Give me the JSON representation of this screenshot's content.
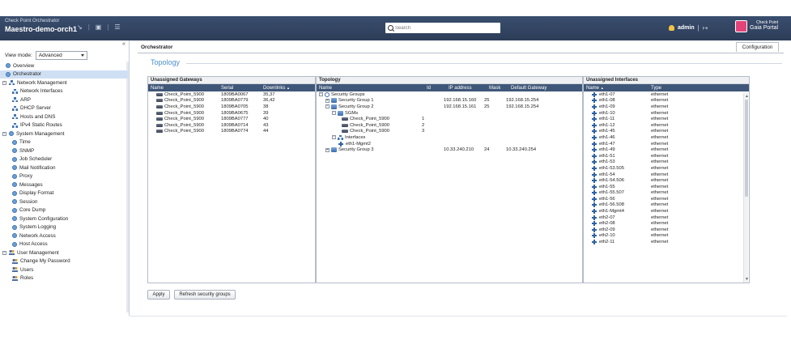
{
  "header": {
    "app_name": "Check Point Orchestrator",
    "host_name": "Maestro-demo-orch1",
    "search_placeholder": "Search",
    "user": "admin",
    "portal_line1": "Check Point",
    "portal_line2": "Gaia Portal"
  },
  "sidebar": {
    "view_mode_label": "View mode:",
    "view_mode_value": "Advanced",
    "items": [
      {
        "label": "Overview"
      },
      {
        "label": "Orchestrator"
      },
      {
        "label": "Network Management"
      },
      {
        "label": "Network Interfaces"
      },
      {
        "label": "ARP"
      },
      {
        "label": "DHCP Server"
      },
      {
        "label": "Hosts and DNS"
      },
      {
        "label": "IPv4 Static Routes"
      },
      {
        "label": "System Management"
      },
      {
        "label": "Time"
      },
      {
        "label": "SNMP"
      },
      {
        "label": "Job Scheduler"
      },
      {
        "label": "Mail Notification"
      },
      {
        "label": "Proxy"
      },
      {
        "label": "Messages"
      },
      {
        "label": "Display Format"
      },
      {
        "label": "Session"
      },
      {
        "label": "Core Dump"
      },
      {
        "label": "System Configuration"
      },
      {
        "label": "System Logging"
      },
      {
        "label": "Network Access"
      },
      {
        "label": "Host Access"
      },
      {
        "label": "User Management"
      },
      {
        "label": "Change My Password"
      },
      {
        "label": "Users"
      },
      {
        "label": "Roles"
      }
    ]
  },
  "main": {
    "breadcrumb": "Orchestrator",
    "config_tab": "Configuration",
    "section_title": "Topology",
    "apply_button": "Apply",
    "refresh_button": "Refresh security groups"
  },
  "unassigned_gateways": {
    "title": "Unassigned Gateways",
    "columns": [
      "Name",
      "Serial",
      "Downlinks"
    ],
    "sort_indicator": "▲",
    "rows": [
      [
        "Check_Point_5900",
        "1809BA0067",
        "35,37"
      ],
      [
        "Check_Point_5900",
        "1809BA0779",
        "36,42"
      ],
      [
        "Check_Point_5900",
        "1809BA0705",
        "38"
      ],
      [
        "Check_Point_5900",
        "1809BA0675",
        "39"
      ],
      [
        "Check_Point_5900",
        "1809BA0777",
        "40"
      ],
      [
        "Check_Point_5900",
        "1809BA0714",
        "43"
      ],
      [
        "Check_Point_5900",
        "1809BA0774",
        "44"
      ]
    ]
  },
  "topology": {
    "title": "Topology",
    "columns": [
      "Name",
      "Id",
      "IP address",
      "Mask",
      "Default Gateway"
    ],
    "rows": [
      {
        "name": "Security Groups",
        "id": "",
        "ip": "",
        "mask": "",
        "gw": ""
      },
      {
        "name": "Security Group 1",
        "id": "",
        "ip": "192.168.15.160",
        "mask": "25",
        "gw": "192.168.15.254"
      },
      {
        "name": "Security Group 2",
        "id": "",
        "ip": "192.168.15.161",
        "mask": "25",
        "gw": "192.168.15.254"
      },
      {
        "name": "SGMs",
        "id": "",
        "ip": "",
        "mask": "",
        "gw": ""
      },
      {
        "name": "Check_Point_5900",
        "id": "1",
        "ip": "",
        "mask": "",
        "gw": ""
      },
      {
        "name": "Check_Point_5900",
        "id": "2",
        "ip": "",
        "mask": "",
        "gw": ""
      },
      {
        "name": "Check_Point_5900",
        "id": "3",
        "ip": "",
        "mask": "",
        "gw": ""
      },
      {
        "name": "Interfaces",
        "id": "",
        "ip": "",
        "mask": "",
        "gw": ""
      },
      {
        "name": "eth1-Mgmt2",
        "id": "",
        "ip": "",
        "mask": "",
        "gw": ""
      },
      {
        "name": "Security Group 3",
        "id": "",
        "ip": "10.33.240.210",
        "mask": "24",
        "gw": "10.33.240.254"
      }
    ]
  },
  "unassigned_interfaces": {
    "title": "Unassigned Interfaces",
    "columns": [
      "Name",
      "Type"
    ],
    "sort_indicator": "▲",
    "rows": [
      [
        "eth1-07",
        "ethernet"
      ],
      [
        "eth1-08",
        "ethernet"
      ],
      [
        "eth1-09",
        "ethernet"
      ],
      [
        "eth1-10",
        "ethernet"
      ],
      [
        "eth1-11",
        "ethernet"
      ],
      [
        "eth1-12",
        "ethernet"
      ],
      [
        "eth1-45",
        "ethernet"
      ],
      [
        "eth1-46",
        "ethernet"
      ],
      [
        "eth1-47",
        "ethernet"
      ],
      [
        "eth1-49",
        "ethernet"
      ],
      [
        "eth1-51",
        "ethernet"
      ],
      [
        "eth1-53",
        "ethernet"
      ],
      [
        "eth1-53.505",
        "ethernet"
      ],
      [
        "eth1-54",
        "ethernet"
      ],
      [
        "eth1-54.506",
        "ethernet"
      ],
      [
        "eth1-55",
        "ethernet"
      ],
      [
        "eth1-55.507",
        "ethernet"
      ],
      [
        "eth1-56",
        "ethernet"
      ],
      [
        "eth1-56.508",
        "ethernet"
      ],
      [
        "eth1-Mgmt4",
        "ethernet"
      ],
      [
        "eth2-07",
        "ethernet"
      ],
      [
        "eth2-08",
        "ethernet"
      ],
      [
        "eth2-09",
        "ethernet"
      ],
      [
        "eth2-10",
        "ethernet"
      ],
      [
        "eth2-11",
        "ethernet"
      ]
    ]
  }
}
